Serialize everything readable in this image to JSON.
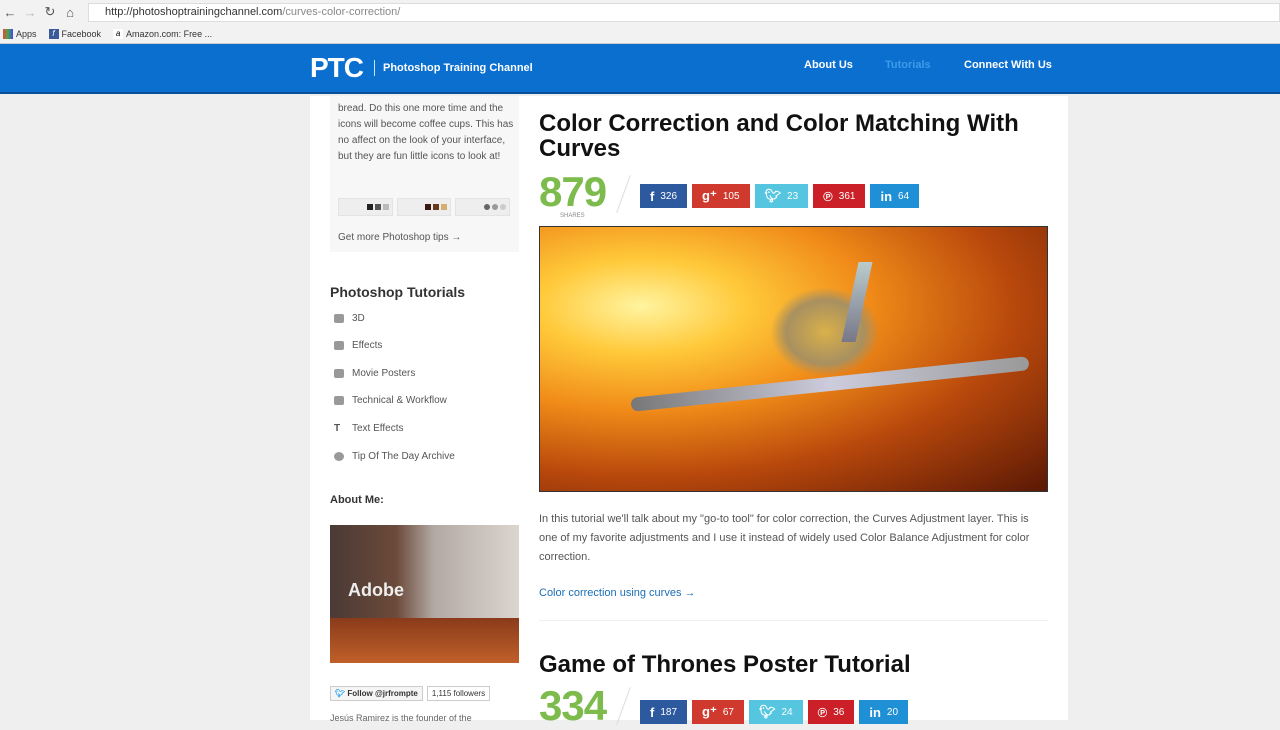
{
  "browser": {
    "url_host": "http://photoshoptrainingchannel.com",
    "url_path": "/curves-color-correction/",
    "bookmarks": [
      "Apps",
      "Facebook",
      "Amazon.com: Free ..."
    ]
  },
  "header": {
    "logo": "PTC",
    "tagline": "Photoshop Training Channel",
    "menu": [
      "About Us",
      "Tutorials",
      "Connect With Us"
    ]
  },
  "sidebar": {
    "tip_text": "bread. Do this one more time and the icons will become coffee cups. This has no affect on the look of your interface, but they are fun little icons to look at!",
    "tip_link": "Get more Photoshop tips →",
    "tutorials_heading": "Photoshop Tutorials",
    "categories": [
      "3D",
      "Effects",
      "Movie Posters",
      "Technical & Workflow",
      "Text Effects",
      "Tip Of The Day Archive"
    ],
    "about_heading": "About Me:",
    "about_image_text": "Adobe",
    "follow_label": "Follow @jrfrompte",
    "followers": "1,115 followers",
    "bio": "Jesús Ramirez is the founder of the"
  },
  "posts": [
    {
      "title": "Color Correction and Color Matching With Curves",
      "shares": "879",
      "shares_label": "SHARES",
      "social": {
        "facebook": "326",
        "google": "105",
        "twitter": "23",
        "pinterest": "361",
        "linkedin": "64"
      },
      "excerpt": "In this tutorial we'll talk about my \"go-to tool\" for color correction, the Curves Adjustment layer. This is one of my favorite adjustments and I use it instead of widely used Color Balance Adjustment for color correction.",
      "link": "Color correction using curves →"
    },
    {
      "title": "Game of Thrones Poster Tutorial",
      "shares": "334",
      "social": {
        "facebook": "187",
        "google": "67",
        "twitter": "24",
        "pinterest": "36",
        "linkedin": "20"
      }
    }
  ],
  "colors": {
    "brand": "#0a6fcf",
    "shares": "#7cbb4c",
    "facebook": "#2d5a9e",
    "google": "#d03a2e",
    "twitter": "#55c5e0",
    "pinterest": "#cb2027",
    "linkedin": "#1f8fd6"
  }
}
